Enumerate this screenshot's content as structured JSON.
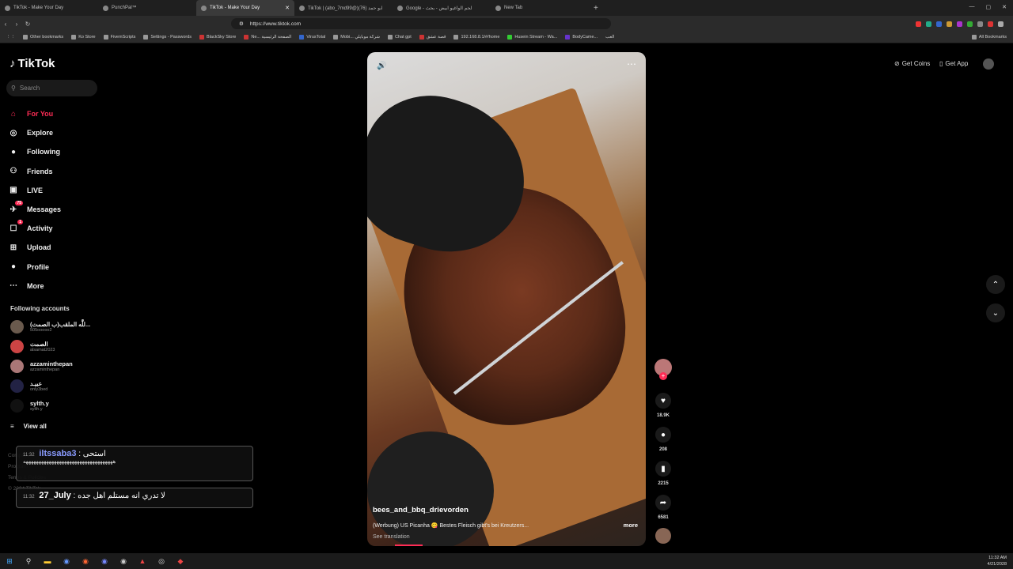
{
  "browser": {
    "tabs": [
      {
        "title": "TikTok - Make Your Day",
        "active": false
      },
      {
        "title": "PunchPal™",
        "active": false
      },
      {
        "title": "TikTok - Make Your Day",
        "active": true
      },
      {
        "title": "TikTok | (abo_7md99@)ابو حمد (76)",
        "active": false
      },
      {
        "title": "Google - لحم الواغيو ابيض - بحث",
        "active": false
      },
      {
        "title": "New Tab",
        "active": false
      }
    ],
    "new_tab": "+",
    "url": "https://www.tiktok.com",
    "bookmarks": [
      "Other bookmarks",
      "Ko Store",
      "FivemScripts",
      "Settings - Passwords",
      "BlackSky Store",
      "Ne... الصفحة الرئيسية",
      "VirusTotal",
      "Mobi... شركة موبايلي",
      "Chat gpt",
      "قصة عشق",
      "192.168.8.1/#/home",
      "Husein Stream - Wa...",
      "BodyCame...",
      "العب"
    ],
    "all_bookmarks": "All Bookmarks"
  },
  "sidebar": {
    "logo": "TikTok",
    "search_placeholder": "Search",
    "items": [
      {
        "label": "For You",
        "icon": "home-icon",
        "glyph": "⌂"
      },
      {
        "label": "Explore",
        "icon": "compass-icon",
        "glyph": "◎"
      },
      {
        "label": "Following",
        "icon": "following-icon",
        "glyph": "●"
      },
      {
        "label": "Friends",
        "icon": "friends-icon",
        "glyph": "⚇"
      },
      {
        "label": "LIVE",
        "icon": "live-icon",
        "glyph": "▣"
      },
      {
        "label": "Messages",
        "icon": "messages-icon",
        "glyph": "✈",
        "badge": "75"
      },
      {
        "label": "Activity",
        "icon": "activity-icon",
        "glyph": "☐",
        "badge": "1"
      },
      {
        "label": "Upload",
        "icon": "upload-icon",
        "glyph": "⊞"
      },
      {
        "label": "Profile",
        "icon": "profile-icon",
        "glyph": "●"
      },
      {
        "label": "More",
        "icon": "more-icon",
        "glyph": "⋯"
      }
    ],
    "following_title": "Following accounts",
    "accounts": [
      {
        "name": "(ب الصمت)للَّه الملقب...",
        "handle": "505ooooo2"
      },
      {
        "name": "الصمت",
        "handle": "alsamat2023"
      },
      {
        "name": "azzaminthepan",
        "handle": "azzaminthepan"
      },
      {
        "name": "عبيـد",
        "handle": "only3bed"
      },
      {
        "name": "sylth.y",
        "handle": "sylth.y"
      }
    ],
    "view_all": "View all",
    "footer": [
      "Company",
      "Program",
      "Terms & Policies",
      "© 2024 TikTok"
    ]
  },
  "chat": [
    {
      "time": "11:32",
      "user": "iltssaba3",
      "msg": ": استحى",
      "extra": "هههههههههههههههههههههههههههههههههههه"
    },
    {
      "time": "11:32",
      "user": "27_July",
      "msg": ": لا تدري انه مستلم اهل جده"
    }
  ],
  "video": {
    "author": "bees_and_bbq_drievorden",
    "description": "(Werbung) US Picanha 😋 Bestes Fleisch gibt's bei Kreutzers...",
    "more": "more",
    "see_translation": "See translation",
    "volume_icon": "🔊",
    "menu_icon": "⋯",
    "progress": 0.1
  },
  "actions": {
    "follow": "+",
    "like_count": "18.9K",
    "comment_count": "208",
    "save_count": "2215",
    "share_count": "6581"
  },
  "topright": {
    "coins": "Get Coins",
    "app": "Get App"
  },
  "arrows": {
    "up": "⌃",
    "down": "⌄"
  },
  "taskbar": {
    "icons": [
      "windows-icon",
      "search-icon",
      "files-icon",
      "steam-icon",
      "browser-icon",
      "discord-icon",
      "app-icon",
      "chrome-icon",
      "obs-icon",
      "vpn-icon"
    ],
    "time": "11:32 AM",
    "date": "4/21/2028"
  },
  "colors": {
    "accent": "#fe2c55",
    "bg": "#000000",
    "chat_user": "#8a9bff"
  }
}
